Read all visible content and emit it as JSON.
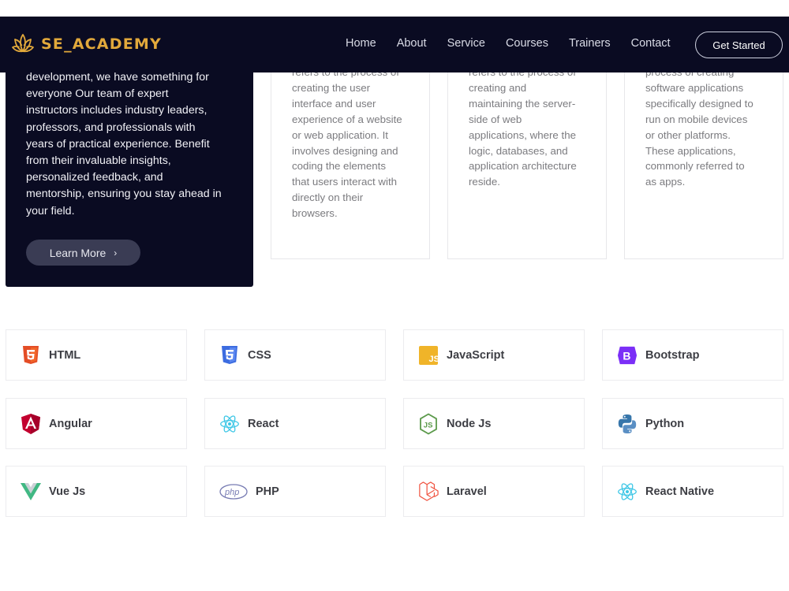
{
  "brand": {
    "name": "SE_ACADEMY",
    "logo_icon": "lotus-icon",
    "color": "#e2a93b"
  },
  "nav": {
    "links": [
      "Home",
      "About",
      "Service",
      "Courses",
      "Trainers",
      "Contact"
    ],
    "cta": "Get Started"
  },
  "intro": {
    "lines": [
      "development, we have something for",
      "everyone Our team of expert",
      "instructors includes industry leaders,",
      "professors, and professionals with",
      "years of practical experience. Benefit",
      "from their invaluable insights,",
      "personalized feedback, and",
      "mentorship, ensuring you stay ahead in",
      "your field."
    ],
    "button": "Learn More",
    "button_icon": "chevron-right-icon"
  },
  "services": [
    {
      "lines": [
        "refers to the process of",
        "creating the user",
        "interface and user",
        "experience of a website",
        "or web application. It",
        "involves designing and",
        "coding the elements",
        "that users interact with",
        "directly on their",
        "browsers."
      ]
    },
    {
      "lines": [
        "refers to the process of",
        "creating and",
        "maintaining the server-",
        "side of web",
        "applications, where the",
        "logic, databases, and",
        "application architecture",
        "reside."
      ]
    },
    {
      "lines": [
        "process of creating",
        "software applications",
        "specifically designed to",
        "run on mobile devices",
        "or other platforms.",
        "These applications,",
        "commonly referred to",
        "as apps."
      ]
    }
  ],
  "technologies": [
    {
      "label": "HTML",
      "icon": "html5-icon",
      "color": "#e44d26"
    },
    {
      "label": "CSS",
      "icon": "css3-icon",
      "color": "#3c6ce0"
    },
    {
      "label": "JavaScript",
      "icon": "javascript-icon",
      "color": "#f0b429"
    },
    {
      "label": "Bootstrap",
      "icon": "bootstrap-icon",
      "color": "#7b2ff7"
    },
    {
      "label": "Angular",
      "icon": "angular-icon",
      "color": "#c3002f"
    },
    {
      "label": "React",
      "icon": "react-icon",
      "color": "#3ec7e6"
    },
    {
      "label": "Node Js",
      "icon": "nodejs-icon",
      "color": "#5c9a4b"
    },
    {
      "label": "Python",
      "icon": "python-icon",
      "color": "#3776ab"
    },
    {
      "label": "Vue Js",
      "icon": "vue-icon",
      "color": "#41b883"
    },
    {
      "label": "PHP",
      "icon": "php-icon",
      "color": "#777bb3"
    },
    {
      "label": "Laravel",
      "icon": "laravel-icon",
      "color": "#f05340"
    },
    {
      "label": "React Native",
      "icon": "react-native-icon",
      "color": "#3ec7e6"
    }
  ]
}
